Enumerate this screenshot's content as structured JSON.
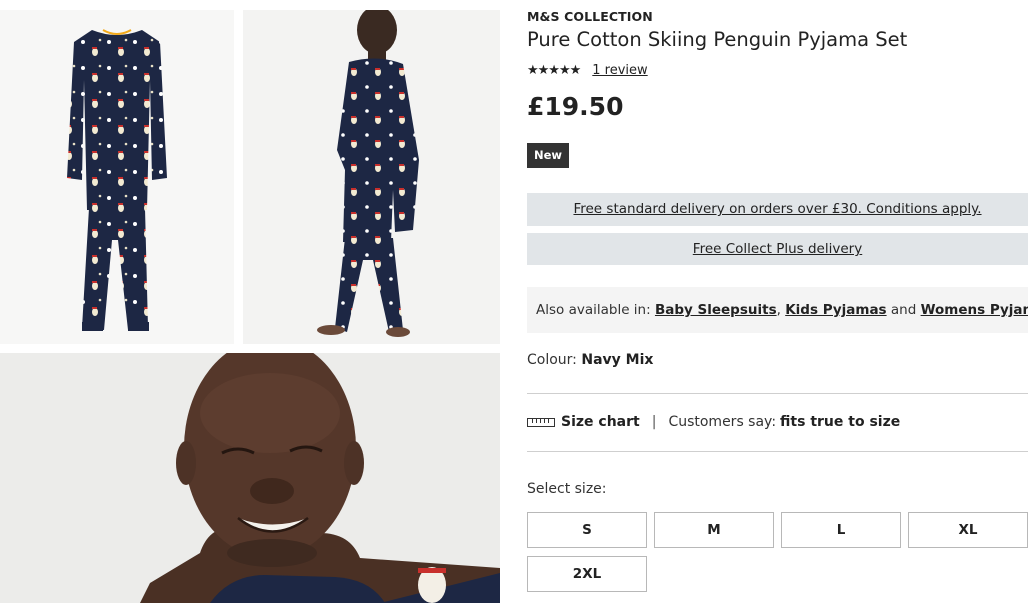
{
  "product": {
    "brand": "M&S COLLECTION",
    "title": "Pure Cotton Skiing Penguin Pyjama Set",
    "rating": {
      "stars_text": "★★★★★",
      "value": 5,
      "out_of": 5,
      "review_link": "1 review"
    },
    "price": "£19.50",
    "badge": "New"
  },
  "delivery": {
    "standard": "Free standard delivery on orders over £30. Conditions apply.",
    "collect": "Free Collect Plus delivery"
  },
  "also_available": {
    "prefix": "Also available in:",
    "links": [
      "Baby Sleepsuits",
      "Kids Pyjamas",
      "Womens Pyjamas"
    ],
    "separator": ",",
    "conjunction": "and"
  },
  "colour": {
    "label": "Colour:",
    "value": "Navy Mix"
  },
  "size_info": {
    "chart_label": "Size chart",
    "divider": "|",
    "customers_say": "Customers say:",
    "fit": "fits true to size"
  },
  "size_select": {
    "label": "Select size:",
    "options": [
      "S",
      "M",
      "L",
      "XL",
      "2XL"
    ]
  },
  "gallery": {
    "images": [
      "pyjama-front-image",
      "model-back-image",
      "model-face-closeup-image"
    ]
  },
  "colors": {
    "navy": "#1d2744",
    "badge_bg": "#333333",
    "delivery_bar": "#e1e5e8",
    "also_bg": "#f4f4f4",
    "divider": "#cfcfcf"
  }
}
